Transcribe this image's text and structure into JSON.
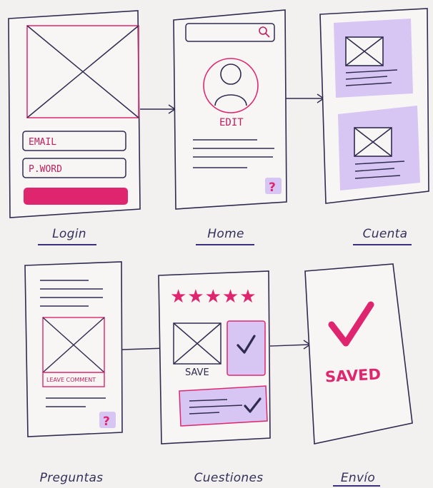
{
  "colors": {
    "background": "#f3f1ef",
    "ink": "#2f2b4f",
    "accent": "#e0256f",
    "panel": "#d7c6f3",
    "caption": "#33305a",
    "underline": "#3a2f7a"
  },
  "screens": {
    "login": {
      "caption": "Login",
      "email_label": "EMAIL",
      "password_label": "P.WORD"
    },
    "home": {
      "caption": "Home",
      "edit_label": "EDIT",
      "help_icon": "question-mark",
      "help_glyph": "?"
    },
    "cuenta": {
      "caption": "Cuenta"
    },
    "preguntas": {
      "caption": "Preguntas",
      "comment_label": "LEAVE COMMENT",
      "help_glyph": "?"
    },
    "cuestiones": {
      "caption": "Cuestiones",
      "save_label": "SAVE",
      "stars": "★★★★★"
    },
    "envio": {
      "caption": "Envío",
      "saved_label": "SAVED"
    }
  }
}
